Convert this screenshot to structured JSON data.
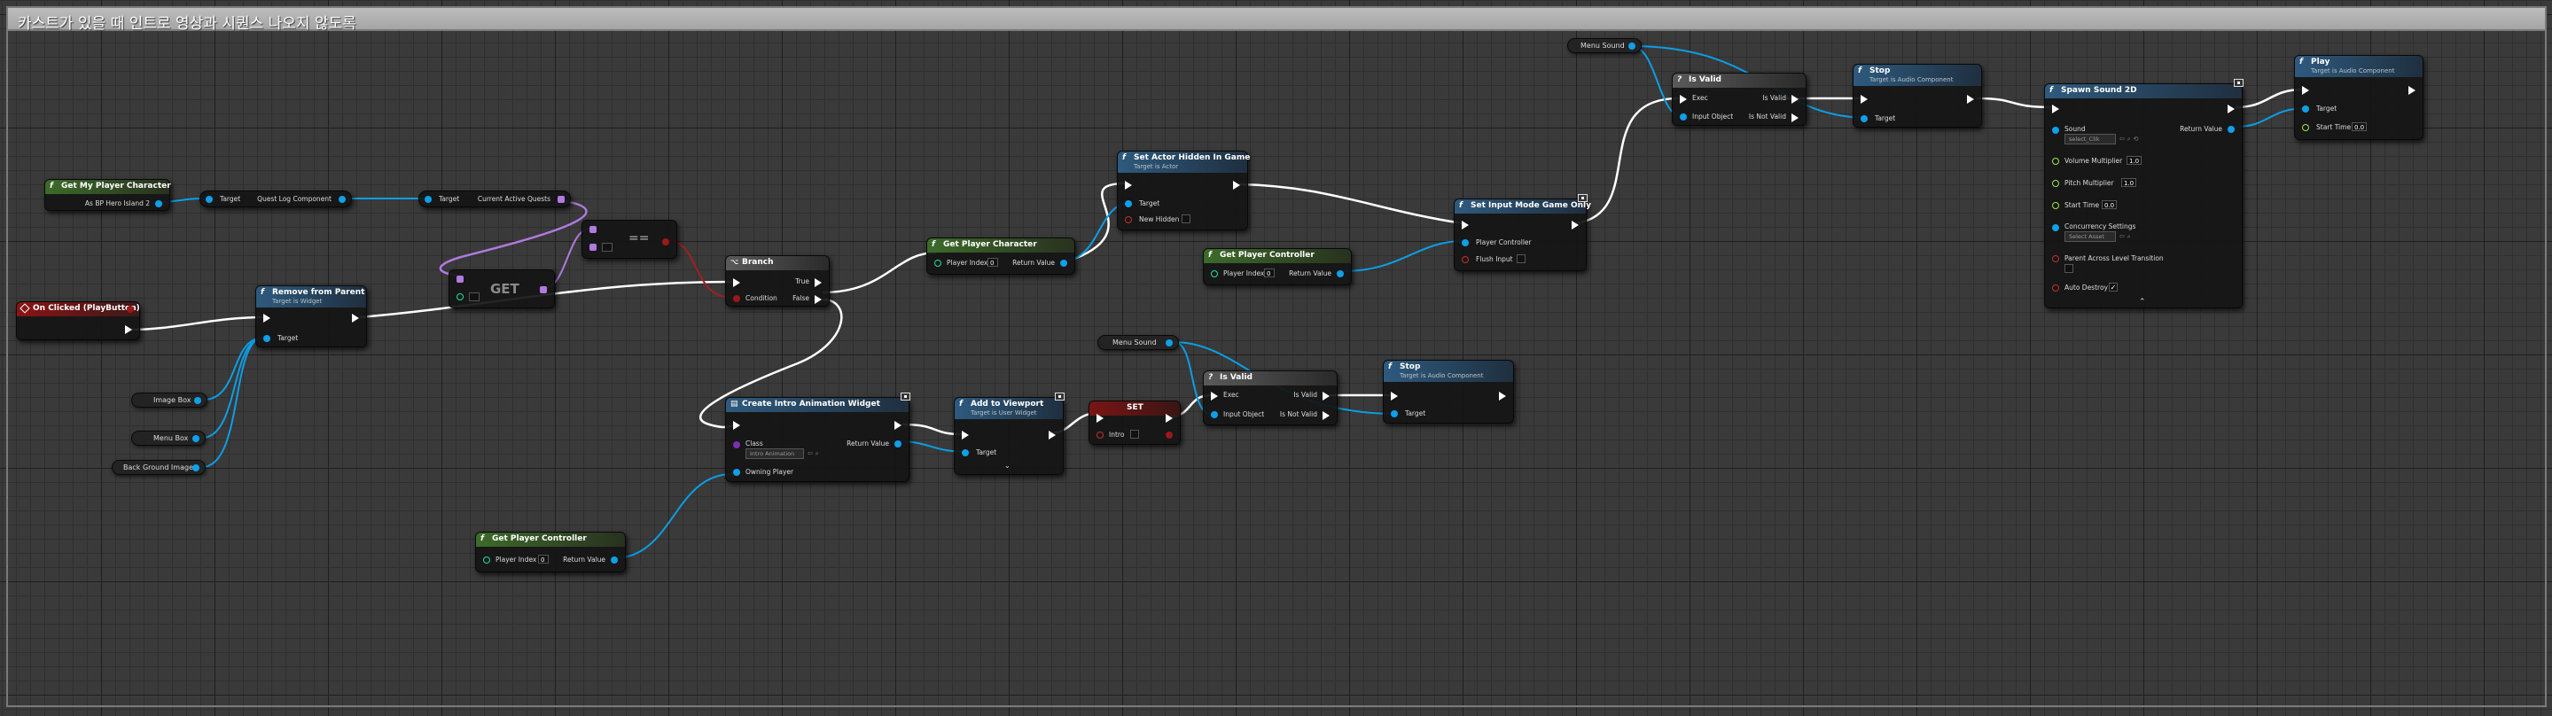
{
  "comment": {
    "title": "카스트가 있을 때 인트로 영상과 시퀀스 나오지 않도록"
  },
  "pins": {
    "target": "Target",
    "return_value": "Return Value",
    "player_index": "Player Index",
    "player_index_value": "0",
    "is_valid": "Is Valid",
    "is_not_valid": "Is Not Valid",
    "exec": "Exec",
    "input_object": "Input Object",
    "condition": "Condition",
    "true_label": "True",
    "false_label": "False",
    "class": "Class",
    "owning_player": "Owning Player",
    "new_hidden": "New Hidden",
    "player_controller": "Player Controller",
    "flush_input": "Flush Input",
    "start_time": "Start Time",
    "start_time_value": "0.0",
    "sound": "Sound",
    "volume_multiplier": "Volume Multiplier",
    "volume_value": "1.0",
    "pitch_multiplier": "Pitch Multiplier",
    "pitch_value": "1.0",
    "concurrency_settings": "Concurrency Settings",
    "parent_across_level": "Parent Across Level Transition",
    "auto_destroy": "Auto Destroy",
    "intro": "Intro"
  },
  "nodes": {
    "get_my_player_character": {
      "title": "Get My Player Character",
      "output": "As BP Hero Island 2"
    },
    "quest_log": {
      "target": "Target",
      "output": "Quest Log Component"
    },
    "current_active_quests": {
      "target": "Target",
      "output": "Current Active Quests"
    },
    "equals": {
      "title": "=="
    },
    "get_array": {
      "title": "GET"
    },
    "on_clicked": {
      "title": "On Clicked (PlayButton)"
    },
    "remove_from_parent": {
      "title": "Remove from Parent",
      "subtitle": "Target is Widget"
    },
    "branch": {
      "title": "Branch"
    },
    "get_player_character": {
      "title": "Get Player Character"
    },
    "set_actor_hidden": {
      "title": "Set Actor Hidden In Game",
      "subtitle": "Target is Actor"
    },
    "get_player_controller_1": {
      "title": "Get Player Controller"
    },
    "set_input_mode": {
      "title": "Set Input Mode Game Only"
    },
    "menu_sound_1": {
      "label": "Menu Sound"
    },
    "is_valid_1": {
      "title": "Is Valid"
    },
    "stop_1": {
      "title": "Stop",
      "subtitle": "Target is Audio Component"
    },
    "spawn_sound_2d": {
      "title": "Spawn Sound 2D",
      "sound_value": "select_Clik",
      "concurrency_value": "Select Asset"
    },
    "play": {
      "title": "Play",
      "subtitle": "Target is Audio Component"
    },
    "image_box": {
      "label": "Image Box"
    },
    "menu_box": {
      "label": "Menu Box"
    },
    "background_image": {
      "label": "Back Ground Image"
    },
    "create_widget": {
      "title": "Create Intro Animation Widget",
      "class_value": "Intro Animation"
    },
    "add_to_viewport": {
      "title": "Add to Viewport",
      "subtitle": "Target is User Widget"
    },
    "set_intro": {
      "title": "SET"
    },
    "menu_sound_2": {
      "label": "Menu Sound"
    },
    "is_valid_2": {
      "title": "Is Valid"
    },
    "stop_2": {
      "title": "Stop",
      "subtitle": "Target is Audio Component"
    },
    "get_player_controller_2": {
      "title": "Get Player Controller"
    }
  },
  "colors": {
    "pure_header": "#3d6b2a",
    "call_header": "#2e5a7e",
    "event_header": "#8b1313",
    "macro_header": "#4a4a4a",
    "exec_wire": "#ffffff",
    "object_wire": "#0c9ee6",
    "array_wire": "#b07ae0",
    "bool_wire": "#a02020"
  }
}
